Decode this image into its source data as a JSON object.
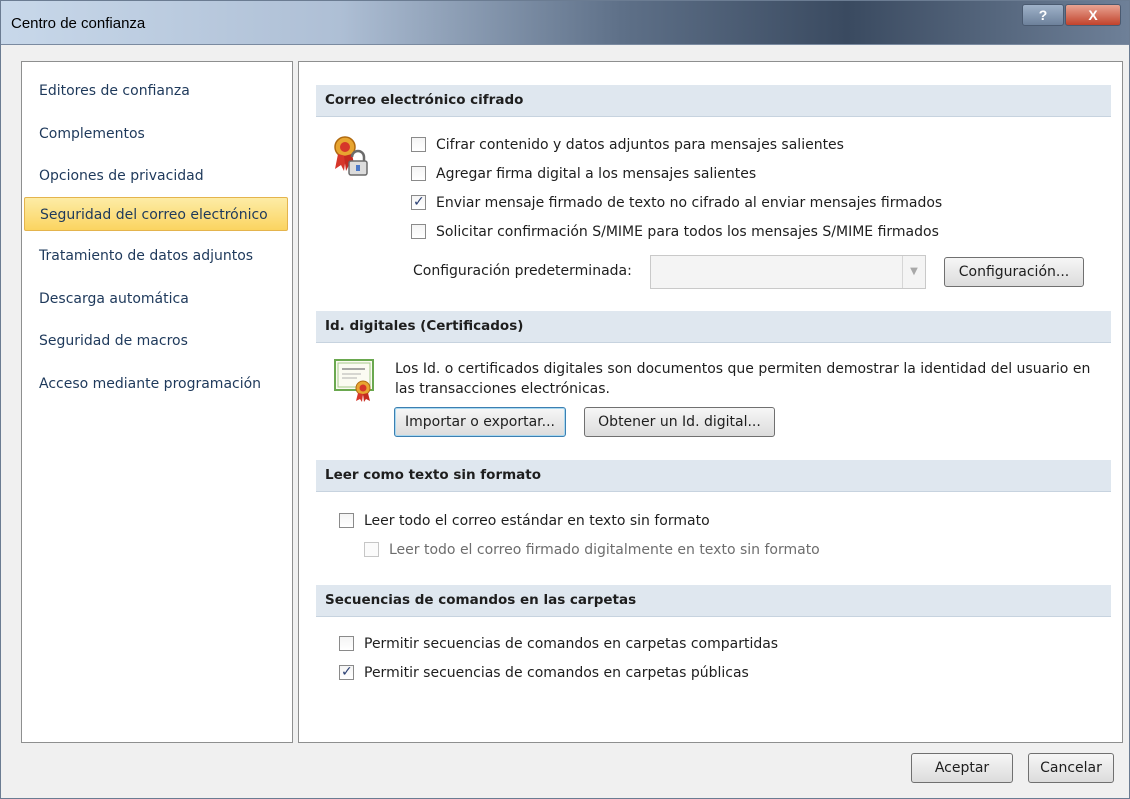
{
  "window": {
    "title": "Centro de confianza",
    "help_label": "?",
    "close_label": "X"
  },
  "nav": {
    "items": [
      {
        "label": "Editores de confianza",
        "selected": false
      },
      {
        "label": "Complementos",
        "selected": false
      },
      {
        "label": "Opciones de privacidad",
        "selected": false
      },
      {
        "label": "Seguridad del correo electrónico",
        "selected": true
      },
      {
        "label": "Tratamiento de datos adjuntos",
        "selected": false
      },
      {
        "label": "Descarga automática",
        "selected": false
      },
      {
        "label": "Seguridad de macros",
        "selected": false
      },
      {
        "label": "Acceso mediante programación",
        "selected": false
      }
    ]
  },
  "encrypted_mail": {
    "header": "Correo electrónico cifrado",
    "icon": "certificate-lock-icon",
    "options": [
      {
        "label": "Cifrar contenido y datos adjuntos para mensajes salientes",
        "checked": false
      },
      {
        "label": "Agregar firma digital a los mensajes salientes",
        "checked": false
      },
      {
        "label": "Enviar mensaje firmado de texto no cifrado al enviar mensajes firmados",
        "checked": true
      },
      {
        "label": "Solicitar confirmación S/MIME para todos los mensajes S/MIME firmados",
        "checked": false
      }
    ],
    "default_config_label": "Configuración predeterminada:",
    "default_config_value": "",
    "config_button": "Configuración..."
  },
  "digital_ids": {
    "header": "Id. digitales (Certificados)",
    "icon": "certificate-icon",
    "description_line1": "Los Id. o certificados digitales son documentos que permiten demostrar la identidad del usuario en",
    "description_line2": "las transacciones electrónicas.",
    "import_export_button": "Importar o exportar...",
    "get_id_button": "Obtener un Id. digital..."
  },
  "plain_text": {
    "header": "Leer como texto sin formato",
    "options": [
      {
        "label": "Leer todo el correo estándar en texto sin formato",
        "checked": false,
        "enabled": true
      },
      {
        "label": "Leer todo el correo firmado digitalmente en texto sin formato",
        "checked": false,
        "enabled": false
      }
    ]
  },
  "folder_scripts": {
    "header": "Secuencias de comandos en las carpetas",
    "options": [
      {
        "label": "Permitir secuencias de comandos en carpetas compartidas",
        "checked": false
      },
      {
        "label": "Permitir secuencias de comandos en carpetas públicas",
        "checked": true
      }
    ]
  },
  "footer": {
    "ok": "Aceptar",
    "cancel": "Cancelar"
  },
  "colors": {
    "accent_selected": "#fbd460",
    "section_header": "#dfe7ef",
    "nav_text": "#1e395b"
  }
}
